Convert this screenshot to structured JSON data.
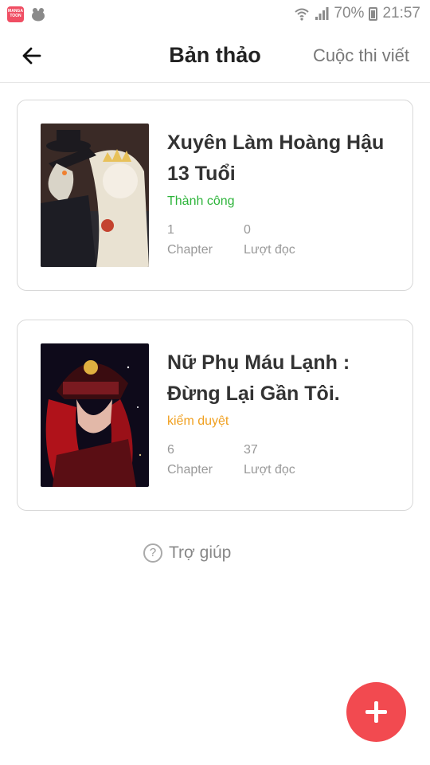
{
  "status_bar": {
    "app_badge": "MANGA TOON",
    "battery": "70%",
    "time": "21:57"
  },
  "header": {
    "title": "Bản thảo",
    "contest_link": "Cuộc thi viết"
  },
  "works": [
    {
      "title": "Xuyên Làm Hoàng Hậu 13 Tuổi",
      "status": "Thành công",
      "status_color": "#2db43a",
      "chapters": "1",
      "chapters_label": "Chapter",
      "reads": "0",
      "reads_label": "Lượt đọc"
    },
    {
      "title": "Nữ Phụ Máu Lạnh : Đừng Lại Gần Tôi.",
      "status": "kiểm duyệt",
      "status_color": "#f0a020",
      "chapters": "6",
      "chapters_label": "Chapter",
      "reads": "37",
      "reads_label": "Lượt đọc"
    }
  ],
  "help": {
    "icon": "question-circle-icon",
    "label": "Trợ giúp"
  },
  "fab": {
    "icon": "plus-icon",
    "color": "#f24a50"
  }
}
